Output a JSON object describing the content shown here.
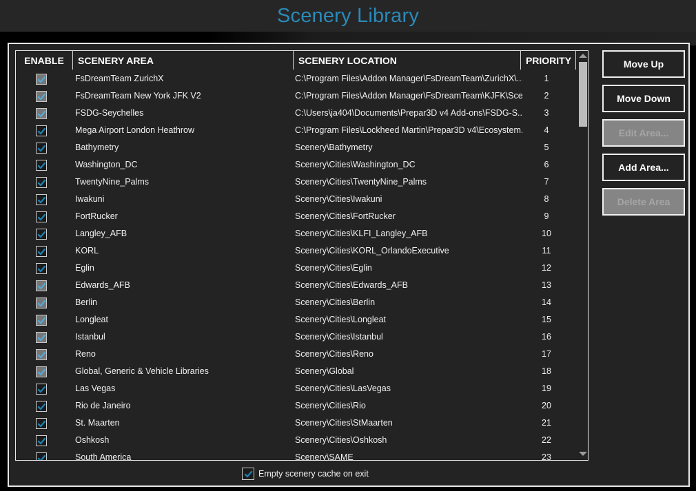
{
  "window": {
    "title": "Scenery Library"
  },
  "colors": {
    "accent": "#2a8ab8",
    "check_enabled": "#1e7fb0",
    "check_dim": "#56a8d4"
  },
  "table": {
    "columns": {
      "enable": "ENABLE",
      "area": "SCENERY AREA",
      "location": "SCENERY LOCATION",
      "priority": "PRIORITY"
    },
    "rows": [
      {
        "enabled": true,
        "dimmed": true,
        "area": "FsDreamTeam ZurichX",
        "location": "C:\\Program Files\\Addon Manager\\FsDreamTeam\\ZurichX\\...",
        "priority": "1"
      },
      {
        "enabled": true,
        "dimmed": true,
        "area": "FsDreamTeam New York JFK V2",
        "location": "C:\\Program Files\\Addon Manager\\FsDreamTeam\\KJFK\\Sce...",
        "priority": "2"
      },
      {
        "enabled": true,
        "dimmed": true,
        "area": "FSDG-Seychelles",
        "location": "C:\\Users\\ja404\\Documents\\Prepar3D v4 Add-ons\\FSDG-S...",
        "priority": "3"
      },
      {
        "enabled": true,
        "dimmed": false,
        "area": "Mega Airport London Heathrow",
        "location": "C:\\Program Files\\Lockheed Martin\\Prepar3D v4\\Ecosystem...",
        "priority": "4"
      },
      {
        "enabled": true,
        "dimmed": false,
        "area": "Bathymetry",
        "location": "Scenery\\Bathymetry",
        "priority": "5"
      },
      {
        "enabled": true,
        "dimmed": false,
        "area": "Washington_DC",
        "location": "Scenery\\Cities\\Washington_DC",
        "priority": "6"
      },
      {
        "enabled": true,
        "dimmed": false,
        "area": "TwentyNine_Palms",
        "location": "Scenery\\Cities\\TwentyNine_Palms",
        "priority": "7"
      },
      {
        "enabled": true,
        "dimmed": false,
        "area": "Iwakuni",
        "location": "Scenery\\Cities\\Iwakuni",
        "priority": "8"
      },
      {
        "enabled": true,
        "dimmed": false,
        "area": "FortRucker",
        "location": "Scenery\\Cities\\FortRucker",
        "priority": "9"
      },
      {
        "enabled": true,
        "dimmed": false,
        "area": "Langley_AFB",
        "location": "Scenery\\Cities\\KLFI_Langley_AFB",
        "priority": "10"
      },
      {
        "enabled": true,
        "dimmed": false,
        "area": "KORL",
        "location": "Scenery\\Cities\\KORL_OrlandoExecutive",
        "priority": "11"
      },
      {
        "enabled": true,
        "dimmed": false,
        "area": "Eglin",
        "location": "Scenery\\Cities\\Eglin",
        "priority": "12"
      },
      {
        "enabled": true,
        "dimmed": true,
        "area": "Edwards_AFB",
        "location": "Scenery\\Cities\\Edwards_AFB",
        "priority": "13"
      },
      {
        "enabled": true,
        "dimmed": true,
        "area": "Berlin",
        "location": "Scenery\\Cities\\Berlin",
        "priority": "14"
      },
      {
        "enabled": true,
        "dimmed": true,
        "area": "Longleat",
        "location": "Scenery\\Cities\\Longleat",
        "priority": "15"
      },
      {
        "enabled": true,
        "dimmed": true,
        "area": "Istanbul",
        "location": "Scenery\\Cities\\Istanbul",
        "priority": "16"
      },
      {
        "enabled": true,
        "dimmed": true,
        "area": "Reno",
        "location": "Scenery\\Cities\\Reno",
        "priority": "17"
      },
      {
        "enabled": true,
        "dimmed": true,
        "area": "Global, Generic & Vehicle Libraries",
        "location": "Scenery\\Global",
        "priority": "18"
      },
      {
        "enabled": true,
        "dimmed": false,
        "area": "Las Vegas",
        "location": "Scenery\\Cities\\LasVegas",
        "priority": "19"
      },
      {
        "enabled": true,
        "dimmed": false,
        "area": "Rio de Janeiro",
        "location": "Scenery\\Cities\\Rio",
        "priority": "20"
      },
      {
        "enabled": true,
        "dimmed": false,
        "area": "St. Maarten",
        "location": "Scenery\\Cities\\StMaarten",
        "priority": "21"
      },
      {
        "enabled": true,
        "dimmed": false,
        "area": "Oshkosh",
        "location": "Scenery\\Cities\\Oshkosh",
        "priority": "22"
      },
      {
        "enabled": true,
        "dimmed": false,
        "area": "South America",
        "location": "Scenery\\SAME",
        "priority": "23"
      }
    ]
  },
  "buttons": {
    "move_up": {
      "label": "Move Up",
      "enabled": true
    },
    "move_down": {
      "label": "Move Down",
      "enabled": true
    },
    "edit_area": {
      "label": "Edit Area...",
      "enabled": false
    },
    "add_area": {
      "label": "Add Area...",
      "enabled": true
    },
    "delete_area": {
      "label": "Delete Area",
      "enabled": false
    }
  },
  "footer": {
    "empty_cache_label": "Empty scenery cache on exit",
    "empty_cache_checked": true
  }
}
